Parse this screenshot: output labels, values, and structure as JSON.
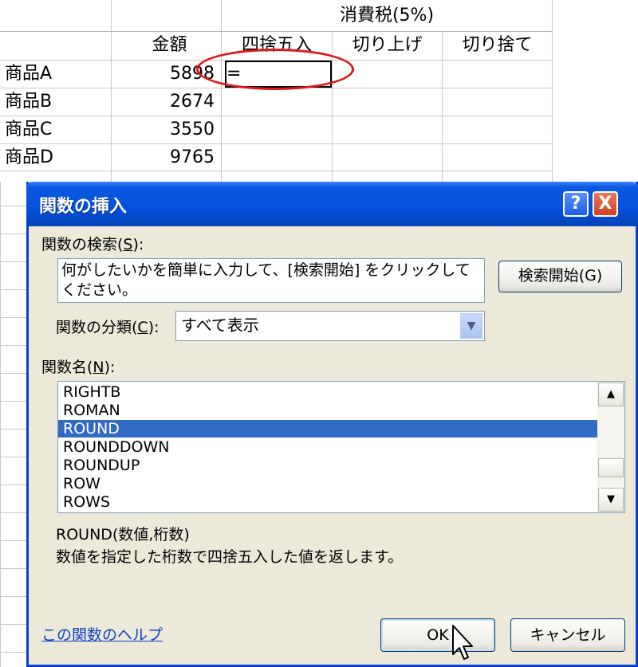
{
  "sheet": {
    "header_tax": "消費税(5%)",
    "col_amount": "金額",
    "col_round": "四捨五入",
    "col_roundup": "切り上げ",
    "col_rounddown": "切り捨て",
    "rows": [
      {
        "name": "商品A",
        "amount": "5898",
        "formula": "="
      },
      {
        "name": "商品B",
        "amount": "2674",
        "formula": ""
      },
      {
        "name": "商品C",
        "amount": "3550",
        "formula": ""
      },
      {
        "name": "商品D",
        "amount": "9765",
        "formula": ""
      }
    ]
  },
  "dialog": {
    "title": "関数の挿入",
    "help_btn": "?",
    "close_btn": "X",
    "search_label": "関数の検索(",
    "search_key": "S",
    "search_label_end": "):",
    "search_text": "何がしたいかを簡単に入力して、[検索開始] をクリックしてください。",
    "search_button": "検索開始(G)",
    "category_label": "関数の分類(",
    "category_key": "C",
    "category_label_end": "):",
    "category_value": "すべて表示",
    "names_label": "関数名(",
    "names_key": "N",
    "names_label_end": "):",
    "functions": [
      "RIGHTB",
      "ROMAN",
      "ROUND",
      "ROUNDDOWN",
      "ROUNDUP",
      "ROW",
      "ROWS"
    ],
    "selected_function": "ROUND",
    "syntax": "ROUND(数値,桁数)",
    "description": "数値を指定した桁数で四捨五入した値を返します。",
    "help_link": "この関数のヘルプ",
    "ok_button": "OK",
    "cancel_button": "キャンセル"
  },
  "colors": {
    "titlebar": "#0550dc",
    "selection": "#316ac5",
    "annotation_circle": "#e01818",
    "dialog_bg": "#ece9d8"
  }
}
